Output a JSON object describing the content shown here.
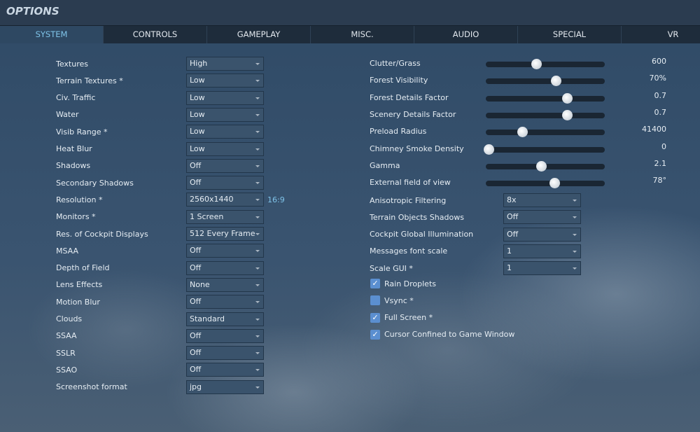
{
  "title": "OPTIONS",
  "tabs": [
    "SYSTEM",
    "CONTROLS",
    "GAMEPLAY",
    "MISC.",
    "AUDIO",
    "SPECIAL",
    "VR"
  ],
  "left": [
    {
      "label": "Textures",
      "value": "High"
    },
    {
      "label": "Terrain Textures *",
      "value": "Low"
    },
    {
      "label": "Civ. Traffic",
      "value": "Low"
    },
    {
      "label": "Water",
      "value": "Low"
    },
    {
      "label": "Visib Range *",
      "value": "Low"
    },
    {
      "label": "Heat Blur",
      "value": "Low"
    },
    {
      "label": "Shadows",
      "value": "Off"
    },
    {
      "label": "Secondary Shadows",
      "value": "Off"
    },
    {
      "label": "Resolution *",
      "value": "2560x1440",
      "extra": "16:9"
    },
    {
      "label": "Monitors *",
      "value": "1 Screen"
    },
    {
      "label": "Res. of Cockpit Displays",
      "value": "512 Every Frame"
    },
    {
      "label": "MSAA",
      "value": "Off"
    },
    {
      "label": "Depth of Field",
      "value": "Off"
    },
    {
      "label": "Lens Effects",
      "value": "None"
    },
    {
      "label": "Motion Blur",
      "value": "Off"
    },
    {
      "label": "Clouds",
      "value": "Standard"
    },
    {
      "label": "SSAA",
      "value": "Off"
    },
    {
      "label": "SSLR",
      "value": "Off"
    },
    {
      "label": "SSAO",
      "value": "Off"
    },
    {
      "label": "Screenshot format",
      "value": "jpg"
    }
  ],
  "sliders": [
    {
      "label": "Clutter/Grass",
      "value": "600",
      "fraction": 0.4
    },
    {
      "label": "Forest Visibility",
      "value": "70%",
      "fraction": 0.565
    },
    {
      "label": "Forest Details Factor",
      "value": "0.7",
      "fraction": 0.66
    },
    {
      "label": "Scenery Details Factor",
      "value": "0.7",
      "fraction": 0.66
    },
    {
      "label": "Preload Radius",
      "value": "41400",
      "fraction": 0.28
    },
    {
      "label": "Chimney Smoke Density",
      "value": "0",
      "fraction": 0.0
    },
    {
      "label": "Gamma",
      "value": "2.1",
      "fraction": 0.44
    },
    {
      "label": "External field of view",
      "value": "78°",
      "fraction": 0.55
    }
  ],
  "right": [
    {
      "label": "Anisotropic Filtering",
      "value": "8x"
    },
    {
      "label": "Terrain Objects Shadows",
      "value": "Off"
    },
    {
      "label": "Cockpit Global Illumination",
      "value": "Off"
    },
    {
      "label": "Messages font scale",
      "value": "1"
    },
    {
      "label": "Scale GUI *",
      "value": "1"
    }
  ],
  "checkboxes": [
    {
      "label": "Rain Droplets",
      "checked": true
    },
    {
      "label": "Vsync *",
      "checked": false
    },
    {
      "label": "Full Screen *",
      "checked": true
    },
    {
      "label": "Cursor Confined to Game Window",
      "checked": true
    }
  ]
}
